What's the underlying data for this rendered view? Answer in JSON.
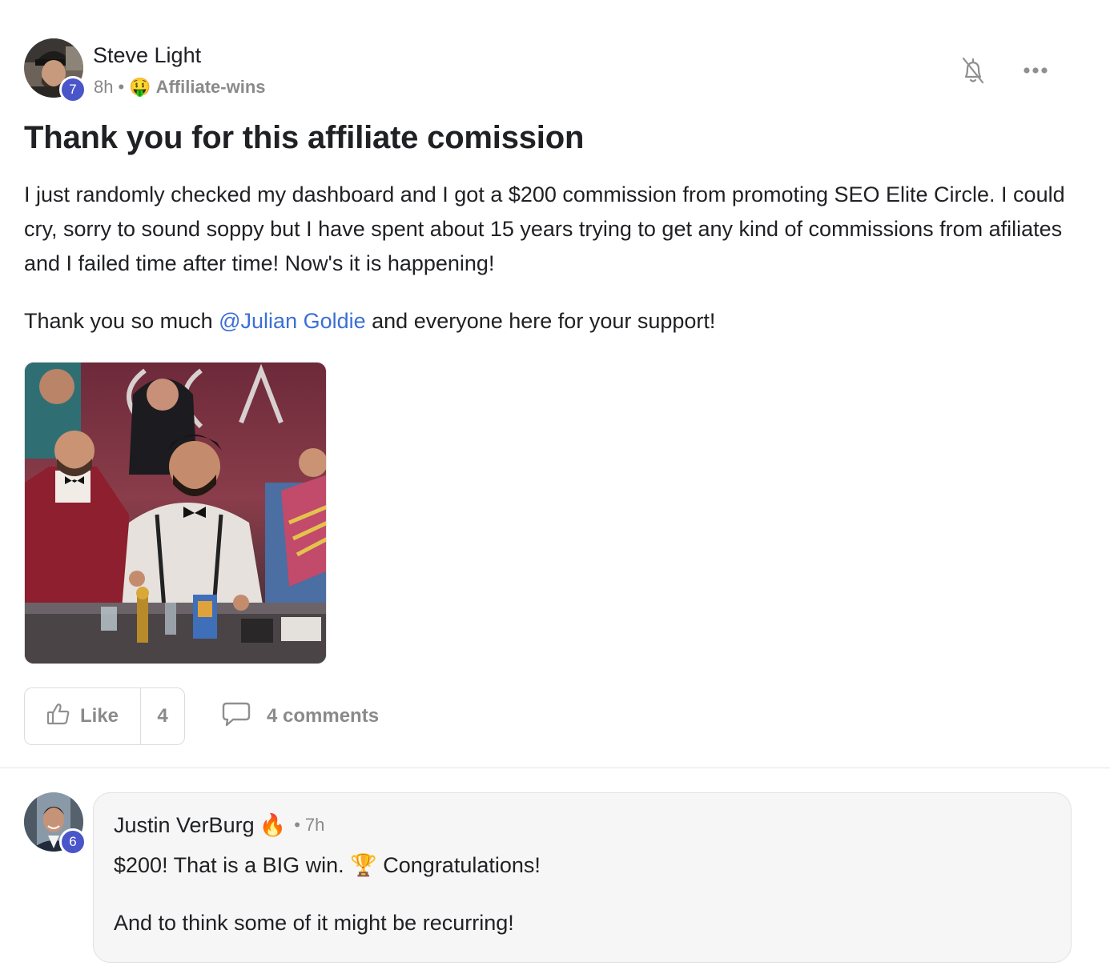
{
  "post": {
    "author": {
      "name": "Steve Light",
      "level": "7"
    },
    "time": "8h",
    "separator": "•",
    "category_emoji": "🤑",
    "category": "Affiliate-wins",
    "title": "Thank you for this affiliate comission",
    "body": {
      "paragraph1": "I just randomly checked my dashboard and I got a $200 commission from promoting SEO Elite Circle. I could cry, sorry to sound soppy but I have spent about 15 years trying to get any kind of commissions from afiliates and I failed time after time! Now's it is happening!",
      "paragraph2_before": "Thank you so much ",
      "mention": "@Julian Goldie",
      "paragraph2_after": " and everyone here for your support!"
    },
    "actions": {
      "like_label": "Like",
      "like_count": "4",
      "comments_label": "4 comments"
    }
  },
  "comment": {
    "author": "Justin VerBurg",
    "author_emoji": "🔥",
    "level": "6",
    "separator": "•",
    "time": "7h",
    "line1": "$200! That is a BIG win. 🏆 Congratulations!",
    "line2": "And to think some of it might be recurring!"
  },
  "icons": {
    "bell": "bell-off-icon",
    "more": "more-options-icon",
    "like": "thumbs-up-icon",
    "comment": "comment-bubble-icon"
  },
  "colors": {
    "accent_link": "#3b6fd6",
    "level_badge": "#4a55c9",
    "muted_text": "#8a8a8a"
  }
}
